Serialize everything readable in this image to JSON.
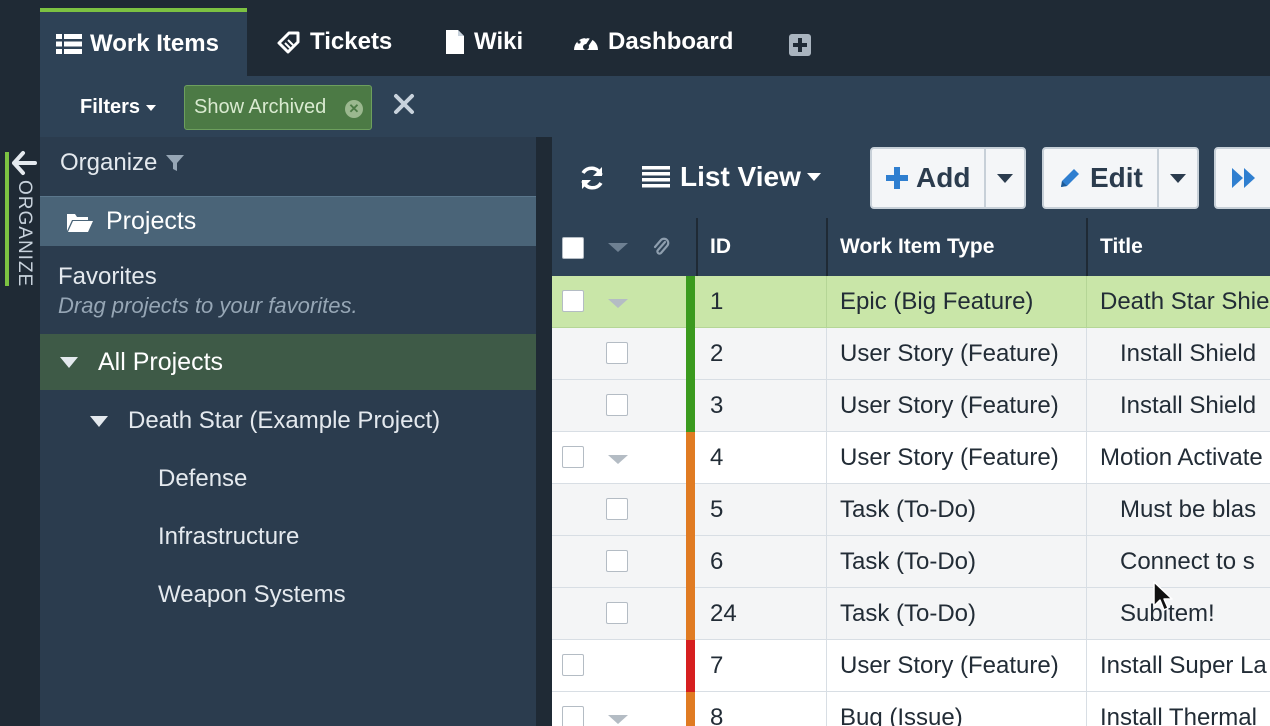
{
  "side_strip": {
    "label": "ORGANIZE"
  },
  "tabs": [
    {
      "label": "Work Items",
      "icon": "list-icon"
    },
    {
      "label": "Tickets",
      "icon": "ticket-icon"
    },
    {
      "label": "Wiki",
      "icon": "document-icon"
    },
    {
      "label": "Dashboard",
      "icon": "dashboard-icon"
    }
  ],
  "filter_bar": {
    "filters_label": "Filters",
    "chip_label": "Show Archived"
  },
  "sidebar": {
    "heading": "Organize",
    "projects_label": "Projects",
    "favorites_title": "Favorites",
    "favorites_hint": "Drag projects to your favorites.",
    "all_projects_label": "All Projects",
    "project": "Death Star (Example Project)",
    "subprojects": [
      "Defense",
      "Infrastructure",
      "Weapon Systems"
    ]
  },
  "toolbar": {
    "view_label": "List View",
    "add_label": "Add",
    "edit_label": "Edit"
  },
  "grid": {
    "columns": {
      "id": "ID",
      "type": "Work Item Type",
      "title": "Title"
    },
    "rows": [
      {
        "id": "1",
        "type": "Epic (Big Feature)",
        "title": "Death Star Shie",
        "level": 0,
        "expandable": true,
        "selected": true,
        "color": "#3a9a1e"
      },
      {
        "id": "2",
        "type": "User Story (Feature)",
        "title": "Install Shield",
        "level": 1,
        "expandable": false,
        "selected": false,
        "color": "#3a9a1e"
      },
      {
        "id": "3",
        "type": "User Story (Feature)",
        "title": "Install Shield",
        "level": 1,
        "expandable": false,
        "selected": false,
        "color": "#3a9a1e"
      },
      {
        "id": "4",
        "type": "User Story (Feature)",
        "title": "Motion Activate",
        "level": 0,
        "expandable": true,
        "selected": false,
        "color": "#e07b22"
      },
      {
        "id": "5",
        "type": "Task (To-Do)",
        "title": "Must be blas",
        "level": 1,
        "expandable": false,
        "selected": false,
        "color": "#e07b22"
      },
      {
        "id": "6",
        "type": "Task (To-Do)",
        "title": "Connect to s",
        "level": 1,
        "expandable": false,
        "selected": false,
        "color": "#e07b22"
      },
      {
        "id": "24",
        "type": "Task (To-Do)",
        "title": "Subitem!",
        "level": 1,
        "expandable": false,
        "selected": false,
        "color": "#e07b22"
      },
      {
        "id": "7",
        "type": "User Story (Feature)",
        "title": "Install Super La",
        "level": 0,
        "expandable": false,
        "selected": false,
        "color": "#d61f1f"
      },
      {
        "id": "8",
        "type": "Bug (Issue)",
        "title": "Install Thermal",
        "level": 0,
        "expandable": true,
        "selected": false,
        "color": "#e07b22"
      }
    ]
  },
  "colors": {
    "accent_green": "#7cc242",
    "dark_bg": "#1f2a35",
    "panel": "#2e4256",
    "selected_row": "#c9e6a8",
    "add_icon": "#2f7fd0"
  }
}
